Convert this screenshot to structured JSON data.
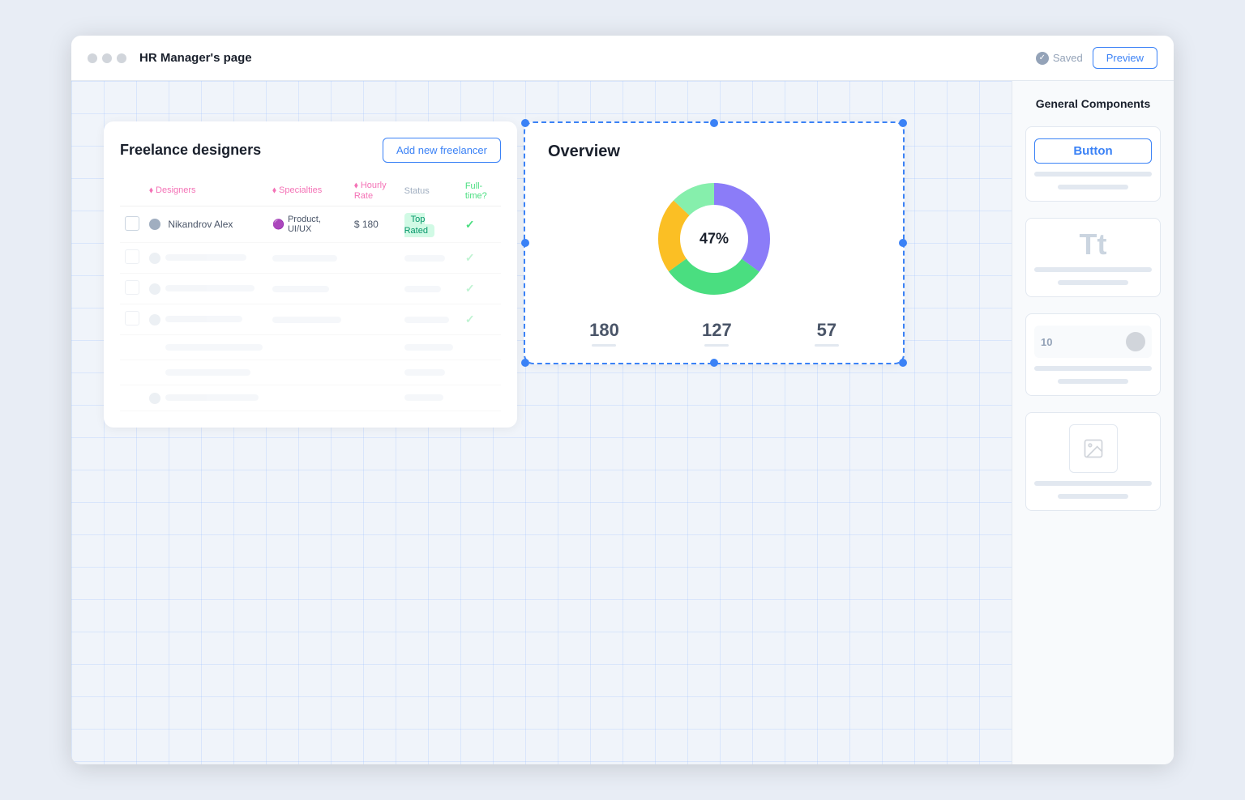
{
  "titlebar": {
    "title": "HR Manager's page",
    "saved_label": "Saved",
    "preview_label": "Preview"
  },
  "freelance_card": {
    "title": "Freelance designers",
    "add_button": "Add new freelancer",
    "table": {
      "headers": [
        "",
        "Designers",
        "Specialties",
        "Hourly Rate",
        "Status",
        "Full-time?"
      ],
      "rows": [
        {
          "name": "Nikandrov Alex",
          "specialty": "Product, UI/UX",
          "rate": "$ 180",
          "status": "Top Rated",
          "full_time": true,
          "avatar_color": "#a0aec0"
        }
      ]
    }
  },
  "overview_widget": {
    "title": "Overview",
    "chart": {
      "center_label": "47%",
      "segments": [
        {
          "label": "purple",
          "color": "#8b7cf8",
          "value": 35
        },
        {
          "label": "green",
          "color": "#4ade80",
          "value": 30
        },
        {
          "label": "yellow",
          "color": "#fbbf24",
          "value": 22
        },
        {
          "label": "light-green",
          "color": "#86efac",
          "value": 13
        }
      ]
    },
    "stats": [
      {
        "value": "180",
        "id": "stat-1"
      },
      {
        "value": "127",
        "id": "stat-2"
      },
      {
        "value": "57",
        "id": "stat-3"
      }
    ]
  },
  "sidebar": {
    "title": "General Components",
    "components": [
      {
        "id": "button-component",
        "label": "Button",
        "type": "button"
      },
      {
        "id": "text-component",
        "label": "Text",
        "type": "text"
      },
      {
        "id": "card-component",
        "label": "Card",
        "type": "card"
      },
      {
        "id": "image-component",
        "label": "Image",
        "type": "image"
      }
    ]
  },
  "icons": {
    "checkmark": "✓"
  }
}
